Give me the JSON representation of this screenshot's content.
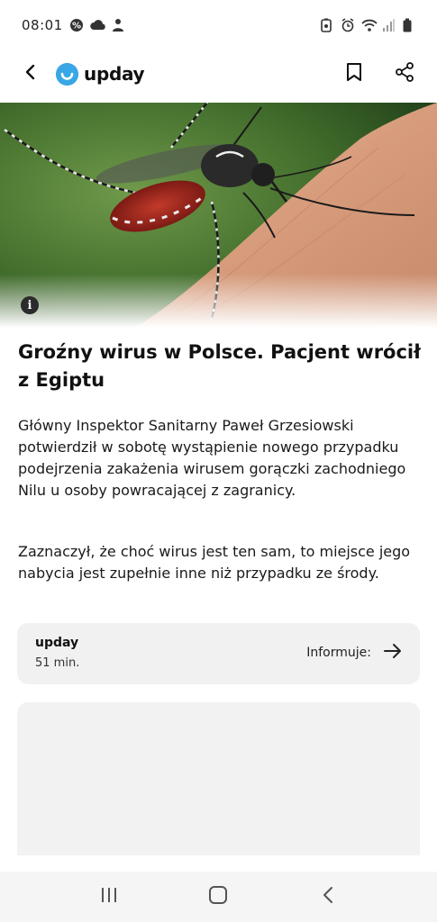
{
  "status_bar": {
    "time": "08:01",
    "left_icons": [
      "notification-badge-icon",
      "cloud-icon",
      "person-icon"
    ],
    "right_icons": [
      "alarm-battery-icon",
      "alarm-clock-icon",
      "wifi-icon",
      "signal-icon",
      "battery-icon"
    ]
  },
  "app_bar": {
    "brand_name": "upday",
    "icons": [
      "back-arrow-icon",
      "bookmark-icon",
      "share-icon"
    ]
  },
  "hero": {
    "info_label": "i"
  },
  "article": {
    "headline": "Groźny wirus w Polsce. Pacjent wrócił z Egiptu",
    "paragraph_1": "Główny Inspektor Sanitarny Paweł Grzesiowski potwierdził w sobotę wystąpienie nowego przypadku podejrzenia zakażenia wirusem gorączki zachodniego Nilu u osoby powracającej z zagranicy.",
    "paragraph_2": "Zaznaczył, że choć wirus jest ten sam, to miejsce jego nabycia jest zupełnie inne niż przypadku ze środy."
  },
  "source_card": {
    "source": "upday",
    "time_ago": "51 min.",
    "link_label": "Informuje:"
  },
  "colors": {
    "brand_accent": "#39a7e6",
    "card_bg": "#f1f1f1",
    "nav_bg": "#f5f5f5"
  }
}
